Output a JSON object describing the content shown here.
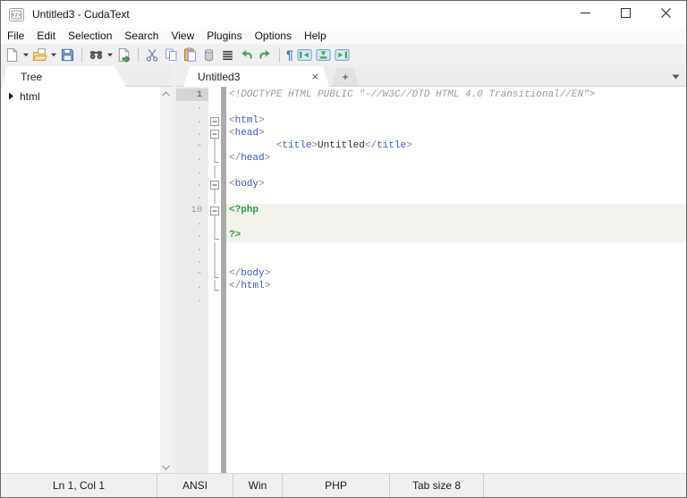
{
  "window": {
    "title": "Untitled3 - CudaText",
    "controls": [
      "minimize-icon",
      "maximize-icon",
      "close-icon"
    ]
  },
  "menu": {
    "items": [
      "File",
      "Edit",
      "Selection",
      "Search",
      "View",
      "Plugins",
      "Options",
      "Help"
    ]
  },
  "toolbar": {
    "buttons": [
      {
        "icon": "new-file-icon"
      },
      {
        "icon": "dropdown-arrow-icon"
      },
      {
        "icon": "open-file-icon"
      },
      {
        "icon": "dropdown-arrow-icon"
      },
      {
        "icon": "save-icon"
      },
      {
        "sep": true
      },
      {
        "icon": "find-icon"
      },
      {
        "icon": "dropdown-arrow-icon"
      },
      {
        "icon": "goto-icon"
      },
      {
        "sep": true
      },
      {
        "icon": "cut-icon"
      },
      {
        "icon": "copy-icon"
      },
      {
        "icon": "paste-icon"
      },
      {
        "icon": "delete-icon"
      },
      {
        "icon": "select-all-icon"
      },
      {
        "icon": "undo-icon"
      },
      {
        "icon": "redo-icon"
      },
      {
        "sep": true
      },
      {
        "icon": "show-whitespace-icon"
      },
      {
        "icon": "toggle-left-panel-icon"
      },
      {
        "icon": "toggle-bottom-panel-icon"
      },
      {
        "icon": "toggle-right-panel-icon"
      }
    ]
  },
  "tabs": {
    "active_label": "Untitled3",
    "close_glyph": "×",
    "new_tab_label": "+"
  },
  "sidebar": {
    "tab_label": "Tree",
    "items": [
      {
        "label": "html",
        "expander": "collapsed"
      }
    ]
  },
  "editor": {
    "lines": [
      {
        "num": "1",
        "current": true,
        "fold": "",
        "segs": [
          [
            "<!DOCTYPE HTML PUBLIC \"-//W3C//DTD HTML 4.0 Transitional//EN\">",
            "doctype"
          ]
        ]
      },
      {
        "num": ".",
        "fold": "",
        "segs": []
      },
      {
        "num": ".",
        "fold": "box",
        "segs": [
          [
            "<",
            "bracket"
          ],
          [
            "html",
            "tag"
          ],
          [
            ">",
            "bracket"
          ]
        ]
      },
      {
        "num": ".",
        "fold": "box",
        "segs": [
          [
            "<",
            "bracket"
          ],
          [
            "head",
            "tag"
          ],
          [
            ">",
            "bracket"
          ]
        ]
      },
      {
        "num": "-",
        "fold": "line",
        "segs": [
          [
            "        ",
            "text"
          ],
          [
            "<",
            "bracket"
          ],
          [
            "title",
            "tag"
          ],
          [
            ">",
            "bracket"
          ],
          [
            "Untitled",
            "text"
          ],
          [
            "</",
            "bracket"
          ],
          [
            "title",
            "tag"
          ],
          [
            ">",
            "bracket"
          ]
        ]
      },
      {
        "num": ".",
        "fold": "end",
        "segs": [
          [
            "</",
            "bracket"
          ],
          [
            "head",
            "tag"
          ],
          [
            ">",
            "bracket"
          ]
        ]
      },
      {
        "num": ".",
        "fold": "line",
        "segs": []
      },
      {
        "num": ".",
        "fold": "box",
        "segs": [
          [
            "<",
            "bracket"
          ],
          [
            "body",
            "tag"
          ],
          [
            ">",
            "bracket"
          ]
        ]
      },
      {
        "num": ".",
        "fold": "line",
        "segs": []
      },
      {
        "num": "10",
        "fold": "box",
        "hl": true,
        "segs": [
          [
            "<?php",
            "php"
          ]
        ]
      },
      {
        "num": ".",
        "fold": "line",
        "hl": true,
        "segs": []
      },
      {
        "num": ".",
        "fold": "end",
        "hl": true,
        "segs": [
          [
            "?>",
            "php"
          ]
        ]
      },
      {
        "num": ".",
        "fold": "line",
        "segs": []
      },
      {
        "num": ".",
        "fold": "line",
        "segs": []
      },
      {
        "num": "-",
        "fold": "end",
        "segs": [
          [
            "</",
            "bracket"
          ],
          [
            "body",
            "tag"
          ],
          [
            ">",
            "bracket"
          ]
        ]
      },
      {
        "num": ".",
        "fold": "end",
        "segs": [
          [
            "</",
            "bracket"
          ],
          [
            "html",
            "tag"
          ],
          [
            ">",
            "bracket"
          ]
        ]
      },
      {
        "num": ".",
        "fold": "",
        "segs": []
      }
    ]
  },
  "statusbar": {
    "cells": [
      {
        "name": "caret-position",
        "label": "Ln 1, Col 1"
      },
      {
        "name": "encoding",
        "label": "ANSI"
      },
      {
        "name": "line-endings",
        "label": "Win"
      },
      {
        "name": "lexer",
        "label": "PHP"
      },
      {
        "name": "tab-size",
        "label": "Tab size 8"
      },
      {
        "name": "message",
        "label": ""
      }
    ]
  },
  "colors": {
    "tag_blue": "#3a55cc",
    "bracket_gray": "#7e7e88",
    "comment_gray": "#9a9aa0",
    "php_green": "#2f9e49",
    "php_block_highlight": "#f3f2ec",
    "chrome_gray": "#f0f0f0",
    "gutter_gray": "#ececec",
    "current_line_number_bg": "#d4d4d4"
  }
}
